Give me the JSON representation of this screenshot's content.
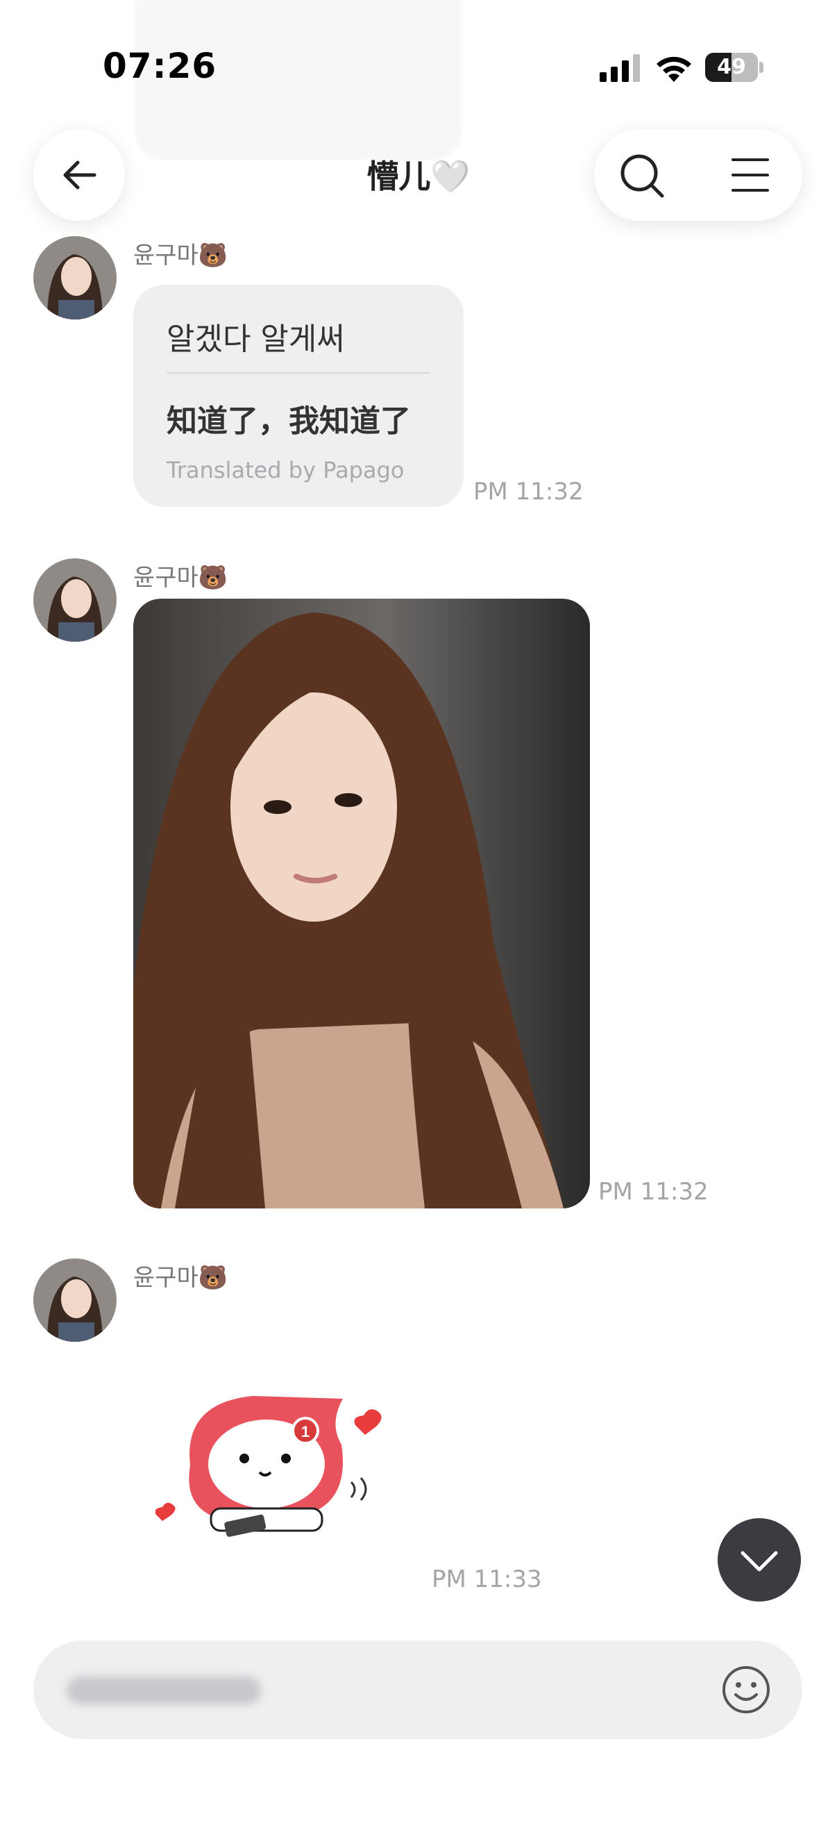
{
  "status_bar": {
    "time": "07:26",
    "battery_level": "49",
    "icons": [
      "cellular-signal-icon",
      "wifi-icon",
      "battery-icon"
    ]
  },
  "header": {
    "title": "懵儿🤍",
    "back_icon": "arrow-left-icon",
    "search_icon": "search-icon",
    "menu_icon": "hamburger-menu-icon"
  },
  "messages": [
    {
      "sender": "윤구마🐻",
      "type": "text",
      "original": "알겠다 알게써",
      "translation": "知道了，我知道了",
      "translation_credit": "Translated by Papago",
      "time": "PM 11:32"
    },
    {
      "sender": "윤구마🐻",
      "type": "photo",
      "time": "PM 11:32"
    },
    {
      "sender": "윤구마🐻",
      "type": "sticker",
      "sticker_badge": "1",
      "time": "PM 11:33"
    }
  ],
  "scroll_down_icon": "chevron-down-icon",
  "input": {
    "emoji_icon": "smiley-icon"
  },
  "colors": {
    "bubble": "#efeff2",
    "timestamp": "#a4a4a8",
    "sticker_red": "#e8525c",
    "scroll_button": "#3a3c42"
  }
}
